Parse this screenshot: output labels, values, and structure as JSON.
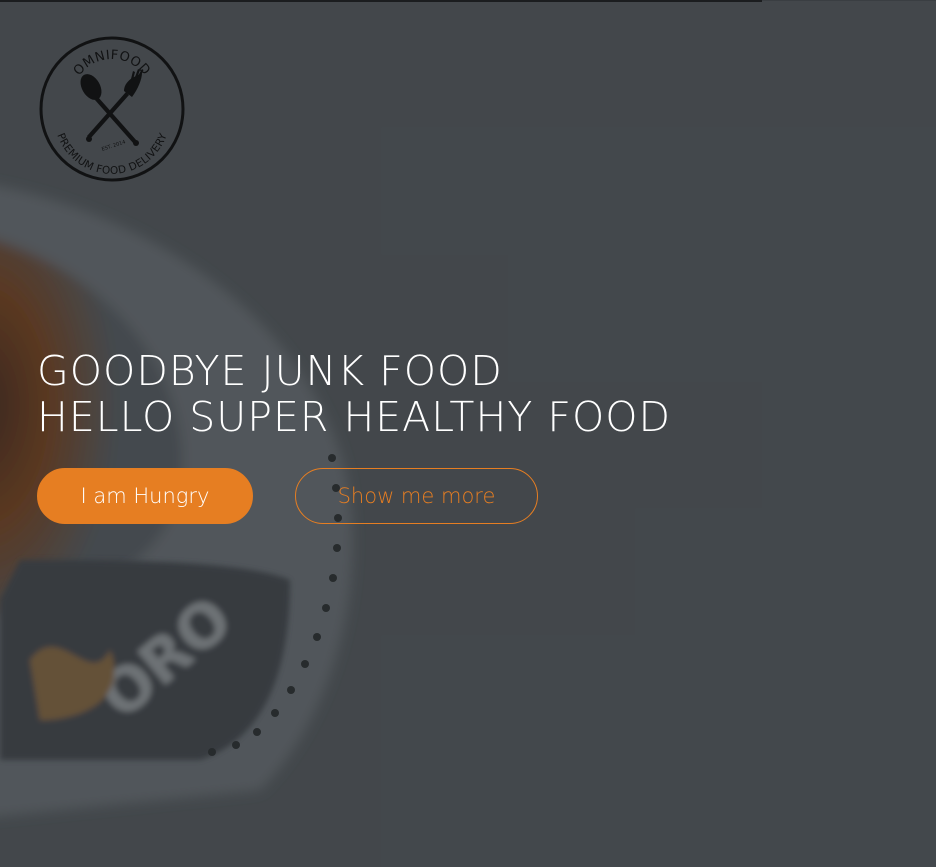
{
  "logo": {
    "icon": "omnifood-logo-icon",
    "brand": "OMNIFOOD",
    "est": "EST. 2014",
    "tagline": "PREMIUM FOOD DELIVERY"
  },
  "hero": {
    "headline_line1": "GOODBYE JUNK FOOD",
    "headline_line2": "HELLO SUPER HEALTHY FOOD",
    "primary_button": "I am Hungry",
    "secondary_button": "Show me more"
  },
  "colors": {
    "accent": "#e67e22",
    "overlay": "#454a4e",
    "text": "#ffffff"
  }
}
